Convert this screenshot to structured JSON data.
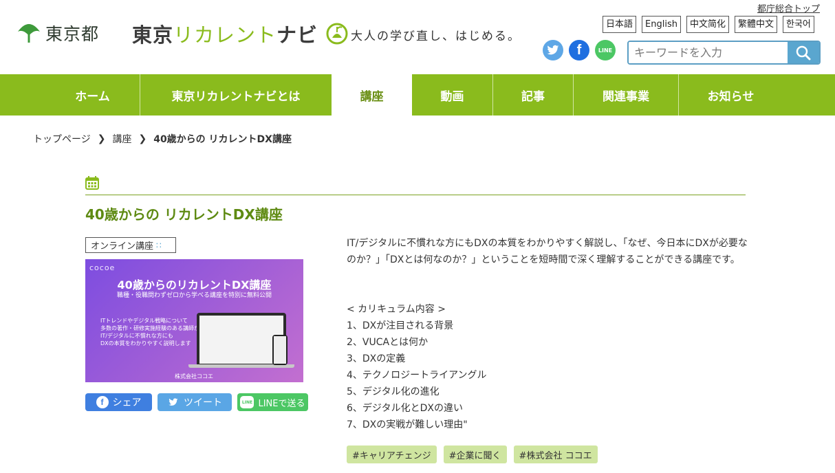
{
  "header": {
    "tokyo_name": "東京都",
    "site_name_part1": "東京",
    "site_name_part2": "リカレント",
    "site_name_part3": "ナビ",
    "tagline": "大人の学び直し、はじめる。",
    "top_link": "都庁総合トップ",
    "languages": [
      "日本語",
      "English",
      "中文简化",
      "繁體中文",
      "한국어"
    ],
    "social_icons": [
      "twitter-icon",
      "facebook-icon",
      "line-icon"
    ],
    "line_text": "LINE",
    "search_placeholder": "キーワードを入力"
  },
  "nav": {
    "items": [
      "ホーム",
      "東京リカレントナビとは",
      "講座",
      "動画",
      "記事",
      "関連事業",
      "お知らせ"
    ],
    "active": "講座"
  },
  "breadcrumb": {
    "items": [
      "トップページ",
      "講座"
    ],
    "current": "40歳からの リカレントDX講座"
  },
  "article": {
    "title": "40歳からの リカレントDX講座",
    "category": "オンライン講座",
    "thumbnail": {
      "brand": "cocoe",
      "title": "40歳からのリカレントDX講座",
      "subtitle": "職種・役職問わずゼロから学べる講座を特別に無料公開",
      "body": "ITトレンドやデジタル戦略について\n多数の著作・研修実施経験のある講師が\nIT/デジタルに不慣れな方にも\nDXの本質をわかりやすく説明します",
      "company": "株式会社ココエ"
    },
    "share": {
      "facebook": "シェア",
      "twitter": "ツイート",
      "line": "LINEで送る",
      "line_icon_text": "LINE"
    },
    "description": "IT/デジタルに不慣れな方にもDXの本質をわかりやすく解説し、「なぜ、今日本にDXが必要なのか？」「DXとは何なのか？」ということを短時間で深く理解することができる講座です。",
    "curriculum_heading": "< カリキュラム内容 >",
    "curriculum": [
      "1、DXが注目される背景",
      "2、VUCAとは何か",
      "3、DXの定義",
      "4、テクノロジートライアングル",
      "5、デジタル化の進化",
      "6、デジタル化とDXの違い",
      "7、DXの実戦が難しい理由\""
    ],
    "tags": [
      "#キャリアチェンジ",
      "#企業に聞く",
      "#株式会社 ココエ"
    ]
  },
  "colors": {
    "brand_green": "#8abb1d",
    "title_green": "#5e8a12",
    "tag_bg": "#cfe5a0",
    "search_blue": "#5aa6cf"
  }
}
